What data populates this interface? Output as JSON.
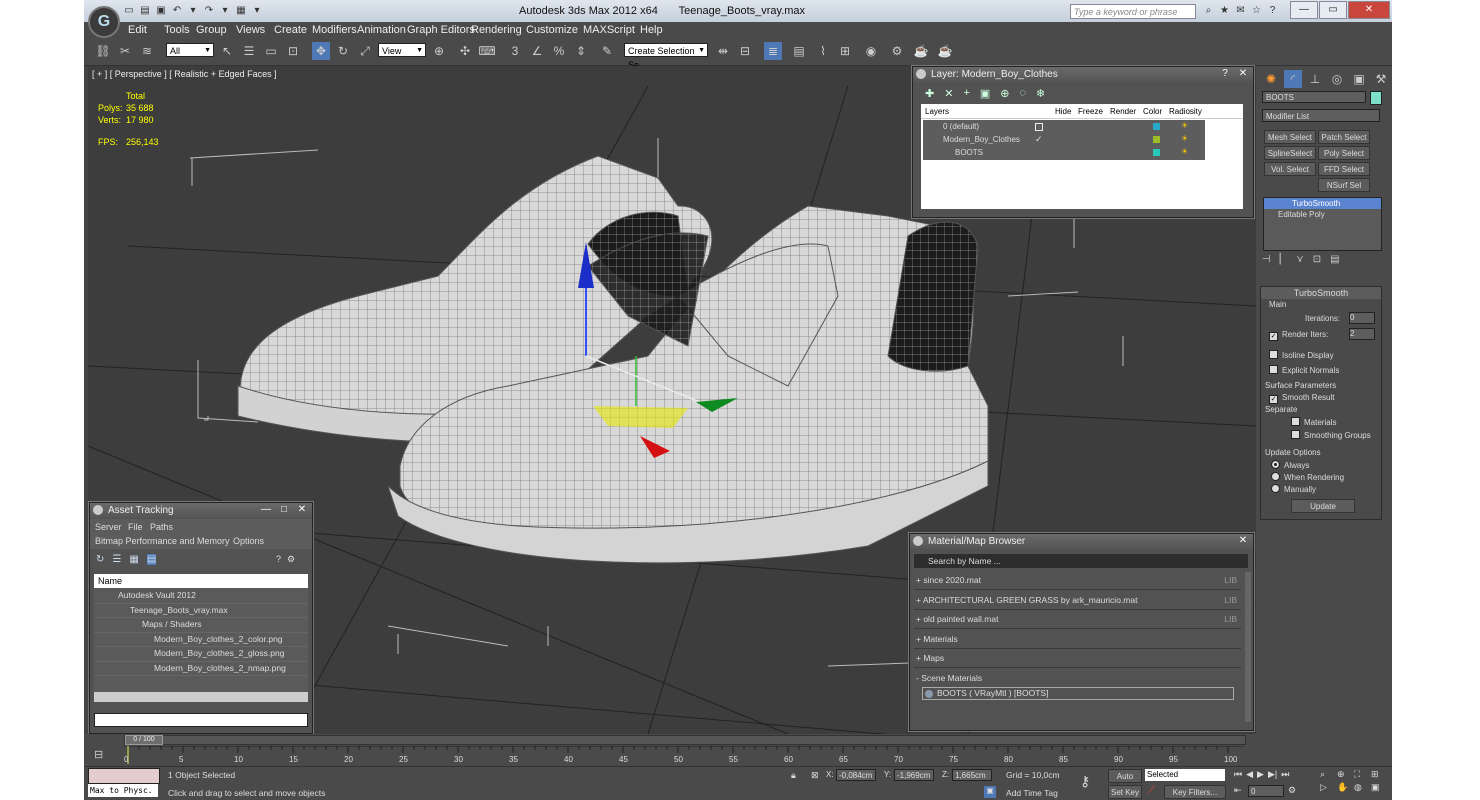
{
  "app": {
    "title": "Autodesk 3ds Max  2012 x64",
    "file": "Teenage_Boots_vray.max",
    "logo": "3ds-max-logo",
    "search_placeholder": "Type a keyword or phrase"
  },
  "menu": [
    "Edit",
    "Tools",
    "Group",
    "Views",
    "Create",
    "Modifiers",
    "Animation",
    "Graph Editors",
    "Rendering",
    "Customize",
    "MAXScript",
    "Help"
  ],
  "toolbar": {
    "selection_filter": "All",
    "ref_coord": "View",
    "named_selection": "Create Selection Se"
  },
  "viewport": {
    "label": "[ + ] [ Perspective ] [ Realistic + Edged Faces ]",
    "stats": {
      "total_label": "Total",
      "polys_label": "Polys:",
      "polys": "35 688",
      "verts_label": "Verts:",
      "verts": "17 980",
      "fps_label": "FPS:",
      "fps": "256,143"
    }
  },
  "layer_dialog": {
    "title": "Layer: Modern_Boy_Clothes",
    "columns": [
      "Layers",
      "Hide",
      "Freeze",
      "Render",
      "Color",
      "Radiosity"
    ],
    "rows": [
      {
        "name": "0 (default)",
        "color": "#2aa8c8"
      },
      {
        "name": "Modern_Boy_Clothes",
        "color": "#9cbd2a"
      },
      {
        "name": "BOOTS",
        "color": "#2ac8b8"
      }
    ]
  },
  "command_panel": {
    "object_name": "BOOTS",
    "object_color": "#7de0c8",
    "modifier_list": "Modifier List",
    "buttons": [
      "Mesh Select",
      "Patch Select",
      "SplineSelect",
      "Poly Select",
      "Vol. Select",
      "FFD Select",
      "NSurf Sel"
    ],
    "stack": [
      "TurboSmooth",
      "Editable Poly"
    ]
  },
  "turbosmooth": {
    "title": "TurboSmooth",
    "main": "Main",
    "iterations_label": "Iterations:",
    "iterations": "0",
    "render_iters_label": "Render Iters:",
    "render_iters": "2",
    "isoline": "Isoline Display",
    "explicit": "Explicit Normals",
    "surface": "Surface Parameters",
    "smooth_result": "Smooth Result",
    "separate": "Separate",
    "materials": "Materials",
    "smoothing_groups": "Smoothing Groups",
    "update_options": "Update Options",
    "always": "Always",
    "when_rendering": "When Rendering",
    "manually": "Manually",
    "update": "Update"
  },
  "asset_tracking": {
    "title": "Asset Tracking",
    "menu1": [
      "Server",
      "File",
      "Paths"
    ],
    "menu2": [
      "Bitmap Performance and Memory",
      "Options"
    ],
    "column": "Name",
    "items": [
      "Autodesk Vault 2012",
      "Teenage_Boots_vray.max",
      "Maps / Shaders",
      "Modern_Boy_clothes_2_color.png",
      "Modern_Boy_clothes_2_gloss.png",
      "Modern_Boy_clothes_2_nmap.png"
    ]
  },
  "material_browser": {
    "title": "Material/Map Browser",
    "search": "Search by Name ...",
    "libs": [
      {
        "name": "+ since 2020.mat",
        "tag": "LIB"
      },
      {
        "name": "+ ARCHITECTURAL GREEN GRASS by ark_mauricio.mat",
        "tag": "LIB"
      },
      {
        "name": "+ old painted wall.mat",
        "tag": "LIB"
      },
      {
        "name": "+ Materials",
        "tag": ""
      },
      {
        "name": "+ Maps",
        "tag": ""
      },
      {
        "name": "- Scene Materials",
        "tag": ""
      }
    ],
    "scene_material": "BOOTS  ( VRayMtl )  [BOOTS]"
  },
  "timeline": {
    "frame": "0 / 100",
    "ticks": [
      "0",
      "5",
      "10",
      "15",
      "20",
      "25",
      "30",
      "35",
      "40",
      "45",
      "50",
      "55",
      "60",
      "65",
      "70",
      "75",
      "80",
      "85",
      "90",
      "95",
      "100"
    ]
  },
  "status": {
    "selected": "1 Object Selected",
    "prompt": "Click and drag to select and move objects",
    "maxscript": "Max to Physc.",
    "x": "-0,084cm",
    "y": "-1,969cm",
    "z": "1,665cm",
    "grid": "Grid = 10,0cm",
    "auto_key": "Auto Key",
    "set_key": "Set Key",
    "key_mode": "Selected",
    "key_filters": "Key Filters...",
    "add_time_tag": "Add Time Tag",
    "frame": "0"
  }
}
